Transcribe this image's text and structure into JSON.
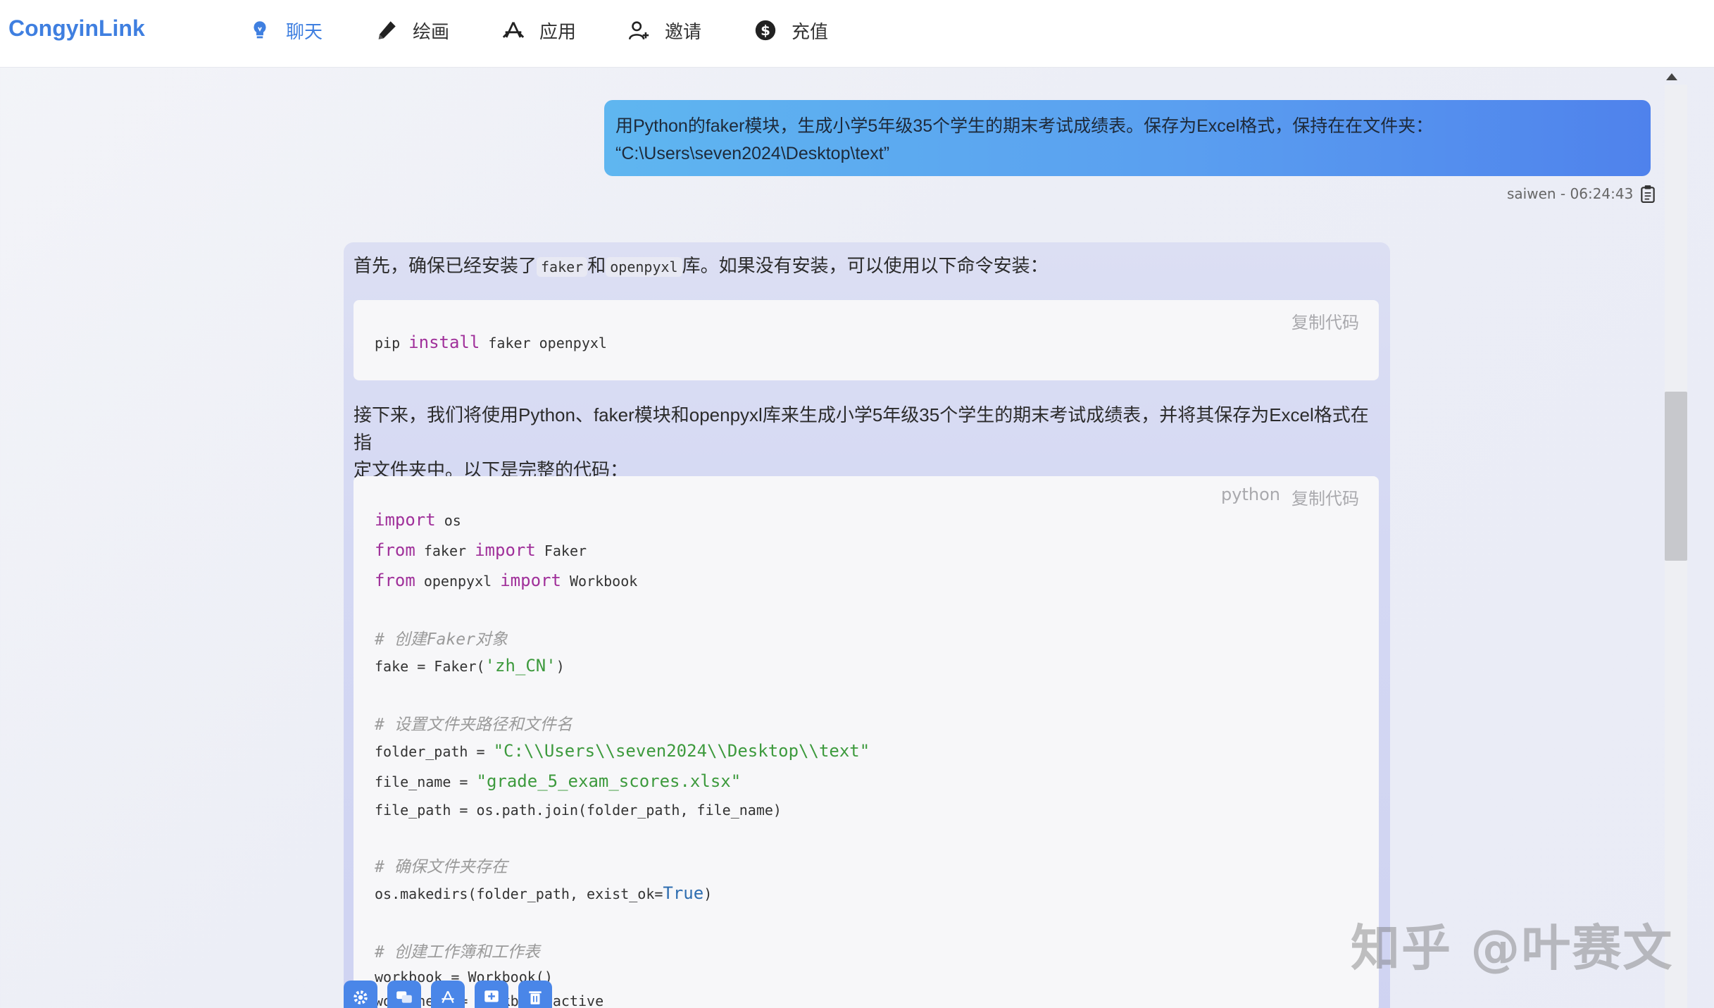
{
  "app": {
    "brand": "CongyinLink"
  },
  "nav": [
    {
      "label": "聊天",
      "icon": "bulb-icon",
      "active": true
    },
    {
      "label": "绘画",
      "icon": "pencil-icon",
      "active": false
    },
    {
      "label": "应用",
      "icon": "app-store-icon",
      "active": false
    },
    {
      "label": "邀请",
      "icon": "invite-user-icon",
      "active": false
    },
    {
      "label": "充值",
      "icon": "dollar-icon",
      "active": false
    }
  ],
  "user_message": {
    "line1": "用Python的faker模块，生成小学5年级35个学生的期末考试成绩表。保存为Excel格式，保持在在文件夹：",
    "line2": "“C:\\Users\\seven2024\\Desktop\\text”",
    "author_time": "saiwen - 06:24:43"
  },
  "assistant_message": {
    "intro_a": "首先，确保已经安装了",
    "intro_code1": "faker",
    "intro_b": "和",
    "intro_code2": "openpyxl",
    "intro_c": "库。如果没有安装，可以使用以下命令安装：",
    "copy_label": "复制代码",
    "code1_lang": "",
    "code1_line": {
      "a": "pip ",
      "kw": "install",
      "b": " faker openpyxl"
    },
    "para2_line1": "接下来，我们将使用Python、faker模块和openpyxl库来生成小学5年级35个学生的期末考试成绩表，并将其保存为Excel格式在指",
    "para2_line2": "定文件夹中。以下是完整的代码：",
    "code2_lang": "python",
    "code2": {
      "l1_kw": "import",
      "l1_rest": " os",
      "l2_kw1": "from",
      "l2_mid": " faker ",
      "l2_kw2": "import",
      "l2_rest": " Faker",
      "l3_kw1": "from",
      "l3_mid": " openpyxl ",
      "l3_kw2": "import",
      "l3_rest": " Workbook",
      "c1": "# 创建Faker对象",
      "l4_a": "fake = Faker(",
      "l4_str": "'zh_CN'",
      "l4_b": ")",
      "c2": "# 设置文件夹路径和文件名",
      "l5_a": "folder_path = ",
      "l5_str": "\"C:\\\\Users\\\\seven2024\\\\Desktop\\\\text\"",
      "l6_a": "file_name = ",
      "l6_str": "\"grade_5_exam_scores.xlsx\"",
      "l7": "file_path = os.path.join(folder_path, file_name)",
      "c3": "# 确保文件夹存在",
      "l8_a": "os.makedirs(folder_path, exist_ok=",
      "l8_bool": "True",
      "l8_b": ")",
      "c4": "# 创建工作簿和工作表",
      "l9": "workbook = Workbook()",
      "l10": "worksheet = workbook.active"
    }
  },
  "toolbar": [
    {
      "icon": "settings-icon"
    },
    {
      "icon": "chat-bubbles-icon"
    },
    {
      "icon": "app-store-icon"
    },
    {
      "icon": "add-message-icon"
    },
    {
      "icon": "trash-icon"
    }
  ],
  "watermark": "知乎 @叶赛文",
  "colors": {
    "accent": "#3f7fe0",
    "user_bubble_start": "#5fb6f0",
    "user_bubble_end": "#4f82ec",
    "keyword": "#a0309a",
    "string": "#3d9a3d"
  }
}
